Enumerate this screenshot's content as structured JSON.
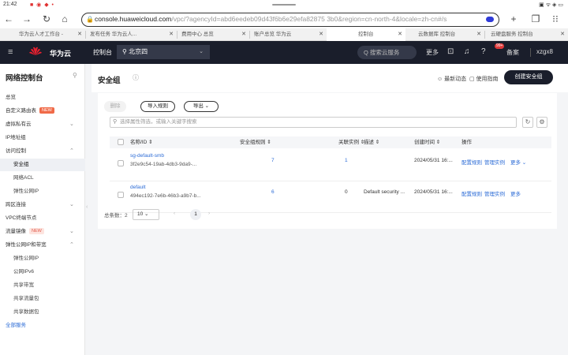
{
  "status_bar": {
    "time": "21:42",
    "icons_right": "▣ ᯤ ◈ ▭"
  },
  "browser": {
    "url_host": "console.huaweicloud.com",
    "url_path": "/vpc/?agencyId=abd6eedeb09d43f6b6e29efa82875 3b0&region=cn-north-4&locale=zh-cn#/s",
    "tabs": [
      "华为云人才工作台 -",
      "发布任务 华为云人...",
      "费用中心 总览",
      "账户总览 华为云",
      "控制台",
      "云数据库 控制台",
      "云硬盘服务 控制台"
    ]
  },
  "topnav": {
    "brand": "华为云",
    "console": "控制台",
    "region": "北京四",
    "search_placeholder": "Q 搜索云服务",
    "more": "更多",
    "badge": "99+",
    "filing": "备案",
    "user": "xzgx8"
  },
  "sidebar": {
    "title": "网络控制台",
    "items": [
      {
        "label": "总览",
        "type": "item"
      },
      {
        "label": "自定义路由表",
        "type": "item",
        "tag": "NEW"
      },
      {
        "label": "虚拟私有云",
        "type": "item",
        "chevron": "⌄"
      },
      {
        "label": "IP地址组",
        "type": "item"
      },
      {
        "label": "访问控制",
        "type": "item",
        "chevron": "⌃"
      },
      {
        "label": "安全组",
        "type": "sub",
        "active": true
      },
      {
        "label": "网络ACL",
        "type": "sub"
      },
      {
        "label": "弹性公网IP",
        "type": "sub"
      },
      {
        "label": "跨区连接",
        "type": "item",
        "chevron": "⌄"
      },
      {
        "label": "VPC终端节点",
        "type": "item"
      },
      {
        "label": "流量镜像",
        "type": "item",
        "tag": "NEW",
        "tagstyle": "pink",
        "chevron": "⌄"
      },
      {
        "label": "弹性公网IP和带宽",
        "type": "item",
        "chevron": "⌃"
      },
      {
        "label": "弹性公网IP",
        "type": "sub"
      },
      {
        "label": "公网IPv6",
        "type": "sub"
      },
      {
        "label": "共享带宽",
        "type": "sub"
      },
      {
        "label": "共享流量包",
        "type": "sub"
      },
      {
        "label": "共享数据包",
        "type": "sub"
      },
      {
        "label": "全部服务",
        "type": "link"
      }
    ]
  },
  "main": {
    "title": "安全组",
    "feedback": "☺ 最新动态",
    "guide": "▢ 使用指南",
    "create": "创建安全组",
    "toolbar": {
      "delete": "删除",
      "rule": "导入规则",
      "export": "导出 ⌄"
    },
    "filter_placeholder": "选择属性筛选，或输入关键字搜索",
    "columns": [
      "名称/ID",
      "安全组规则",
      "关联实例",
      "描述",
      "创建时间",
      "操作"
    ],
    "rows": [
      {
        "name": "sg-default-smb",
        "id": "3f2e9c54-19ab-4db3-9da9-...",
        "rules": "7",
        "instances": "1",
        "desc": "",
        "created": "2024/05/31 16:...",
        "ops": [
          "配置规则",
          "管理实例",
          "更多 ⌄"
        ]
      },
      {
        "name": "default",
        "id": "494ec192-7e6b-46b3-a9b7-b...",
        "rules": "6",
        "instances": "0",
        "desc": "Default security ...",
        "created": "2024/05/31 16:...",
        "ops": [
          "配置规则",
          "管理实例",
          "更多"
        ]
      }
    ],
    "pager": {
      "total": "总条数：2",
      "size": "10",
      "page": "1"
    }
  }
}
